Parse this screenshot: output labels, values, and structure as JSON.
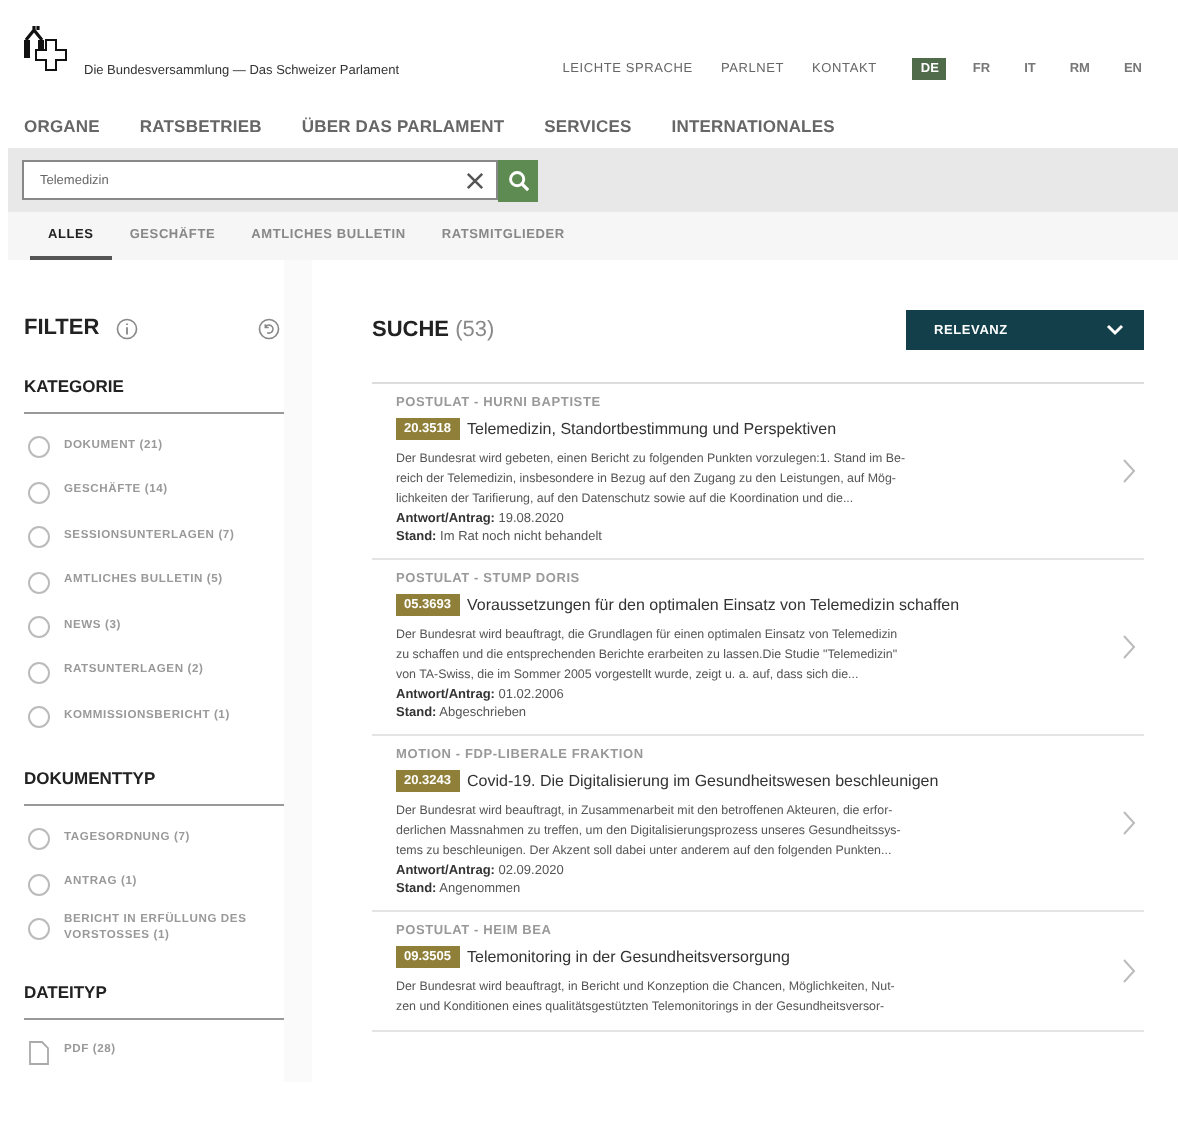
{
  "header": {
    "site_title": "Die Bundesversammlung — Das Schweizer Parlament",
    "links": [
      "LEICHTE SPRACHE",
      "PARLNET",
      "KONTAKT"
    ],
    "languages": [
      {
        "label": "DE",
        "selected": true
      },
      {
        "label": "FR",
        "selected": false
      },
      {
        "label": "IT",
        "selected": false
      },
      {
        "label": "RM",
        "selected": false
      },
      {
        "label": "EN",
        "selected": false
      }
    ]
  },
  "nav": [
    "ORGANE",
    "RATSBETRIEB",
    "ÜBER DAS PARLAMENT",
    "SERVICES",
    "INTERNATIONALES"
  ],
  "search": {
    "value": "Telemedizin"
  },
  "tabs": [
    {
      "label": "ALLES",
      "selected": true
    },
    {
      "label": "GESCHÄFTE",
      "selected": false
    },
    {
      "label": "AMTLICHES BULLETIN",
      "selected": false
    },
    {
      "label": "RATSMITGLIEDER",
      "selected": false
    }
  ],
  "filter": {
    "title": "FILTER",
    "groups": [
      {
        "title": "KATEGORIE",
        "items": [
          {
            "label": "DOKUMENT (21)",
            "kind": "radio",
            "checked": false
          },
          {
            "label": "GESCHÄFTE (14)",
            "kind": "radio",
            "checked": false
          },
          {
            "label": "SESSIONSUNTERLAGEN (7)",
            "kind": "radio",
            "checked": false
          },
          {
            "label": "AMTLICHES BULLETIN (5)",
            "kind": "radio",
            "checked": false
          },
          {
            "label": "NEWS (3)",
            "kind": "radio",
            "checked": false
          },
          {
            "label": "RATSUNTERLAGEN (2)",
            "kind": "radio",
            "checked": false
          },
          {
            "label": "KOMMISSIONSBERICHT (1)",
            "kind": "radio",
            "checked": false
          }
        ]
      },
      {
        "title": "DOKUMENTTYP",
        "items": [
          {
            "label": "TAGESORDNUNG (7)",
            "kind": "radio",
            "checked": false
          },
          {
            "label": "ANTRAG (1)",
            "kind": "radio",
            "checked": false
          },
          {
            "label": "BERICHT IN ERFÜLLUNG DES VORSTOSSES (1)",
            "kind": "radio",
            "checked": false
          }
        ]
      },
      {
        "title": "DATEITYP",
        "items": [
          {
            "label": "PDF (28)",
            "kind": "file"
          }
        ]
      }
    ]
  },
  "results": {
    "title": "SUCHE",
    "count": "(53)",
    "sort": "RELEVANZ",
    "items": [
      {
        "category": "POSTULAT - HURNI BAPTISTE",
        "number": "20.3518",
        "title": "Telemedizin, Standortbestimmung und Perspektiven",
        "abstract": [
          "Der Bundesrat wird gebeten, einen Bericht zu folgenden Punkten vorzulegen:1. Stand im Be-",
          "reich der Telemedizin, insbesondere in Bezug auf den Zugang zu den Leistungen, auf Mög-",
          "lichkeiten der Tarifierung, auf den Datenschutz sowie auf die Koordination und die..."
        ],
        "date_label": "Antwort/Antrag:",
        "date": "19.08.2020",
        "status_label": "Stand:",
        "status": "Im Rat noch nicht behandelt"
      },
      {
        "category": "POSTULAT - STUMP DORIS",
        "number": "05.3693",
        "title": "Voraussetzungen für den optimalen Einsatz von Telemedizin schaffen",
        "abstract": [
          "Der Bundesrat wird beauftragt, die Grundlagen für einen optimalen Einsatz von Telemedizin",
          "zu schaffen und die entsprechenden Berichte erarbeiten zu lassen.Die Studie \"Telemedizin\"",
          "von TA-Swiss, die im Sommer 2005 vorgestellt wurde, zeigt u. a. auf, dass sich die..."
        ],
        "date_label": "Antwort/Antrag:",
        "date": "01.02.2006",
        "status_label": "Stand:",
        "status": "Abgeschrieben"
      },
      {
        "category": "MOTION - FDP-LIBERALE FRAKTION",
        "number": "20.3243",
        "title": "Covid-19. Die Digitalisierung im Gesundheitswesen beschleunigen",
        "abstract": [
          "Der Bundesrat wird beauftragt, in Zusammenarbeit mit den betroffenen Akteuren, die erfor-",
          "derlichen Massnahmen zu treffen, um den Digitalisierungsprozess unseres Gesundheitssys-",
          "tems zu beschleunigen. Der Akzent soll dabei unter anderem auf den folgenden Punkten..."
        ],
        "date_label": "Antwort/Antrag:",
        "date": "02.09.2020",
        "status_label": "Stand:",
        "status": "Angenommen"
      },
      {
        "category": "POSTULAT - HEIM BEA",
        "number": "09.3505",
        "title": "Telemonitoring in der Gesundheitsversorgung",
        "abstract": [
          "Der Bundesrat wird beauftragt, in Bericht und Konzeption die Chancen, Möglichkeiten, Nut-",
          "zen und Konditionen eines qualitätsgestützten Telemonitorings in der Gesundheitsversor-"
        ]
      }
    ]
  }
}
